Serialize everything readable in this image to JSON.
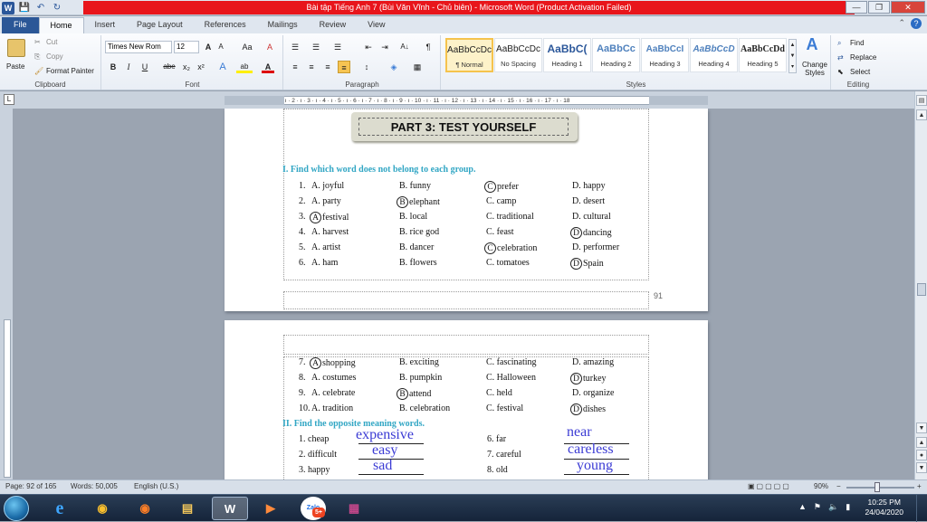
{
  "window": {
    "title": "Bài tập Tiếng Anh 7 (Bùi Văn Vĩnh - Chủ biên)  -  Microsoft Word (Product Activation Failed)",
    "qat_logo": "W",
    "qat_save": "💾",
    "qat_undo": "↶",
    "qat_redo": "↻",
    "minimize": "—",
    "restore": "❐",
    "close": "✕"
  },
  "tabs": [
    "File",
    "Home",
    "Insert",
    "Page Layout",
    "References",
    "Mailings",
    "Review",
    "View"
  ],
  "tab_icons": {
    "minimize_ribbon": "⌃",
    "help": "?"
  },
  "ribbon": {
    "clipboard": {
      "label": "Clipboard",
      "paste": "Paste",
      "cut": "Cut",
      "copy": "Copy",
      "format_painter": "Format Painter"
    },
    "font": {
      "label": "Font",
      "family": "Times New Rom",
      "size": "12",
      "grow": "A",
      "shrink": "A",
      "case": "Aa",
      "clear": "A",
      "bold": "B",
      "italic": "I",
      "underline": "U",
      "strike": "abe",
      "subscript": "x₂",
      "superscript": "x²",
      "effects": "A",
      "highlight": "ab",
      "color": "A"
    },
    "paragraph": {
      "label": "Paragraph",
      "bullets": "☰",
      "numbering": "☰",
      "multilevel": "☰",
      "decrease": "⇤",
      "increase": "⇥",
      "sort": "A↓",
      "pilcrow": "¶",
      "align_left": "≡",
      "center": "≡",
      "align_right": "≡",
      "justify": "≡",
      "spacing": "↕",
      "shading": "◈",
      "borders": "▦"
    },
    "styles": {
      "label": "Styles",
      "cards": [
        {
          "sample": "AaBbCcDc",
          "name": "¶ Normal"
        },
        {
          "sample": "AaBbCcDc",
          "name": "No Spacing"
        },
        {
          "sample": "AaBbC(",
          "name": "Heading 1"
        },
        {
          "sample": "AaBbCc",
          "name": "Heading 2"
        },
        {
          "sample": "AaBbCcI",
          "name": "Heading 3"
        },
        {
          "sample": "AaBbCcD",
          "name": "Heading 4"
        },
        {
          "sample": "AaBbCcDd",
          "name": "Heading 5"
        }
      ],
      "change_styles": "Change Styles",
      "change_icon": "A"
    },
    "editing": {
      "label": "Editing",
      "find": "Find",
      "replace": "Replace",
      "select": "Select"
    }
  },
  "ruler_text": "· 2 · ı · 1 · ı · ▽ · ı · 1 · ı · 2 · ı · 3 · ı · 4 · ı · 5 · ı · 6 · ı · 7 · ı · 8 · ı · 9 · ı · 10 · ı · 11 · ı · 12 · ı · 13 · ı · 14 · ı · 15 · ı · 16 · ı · 17 · ı · 18",
  "ruler_tab_symbol": "L",
  "document": {
    "part_title": "PART 3: TEST YOURSELF",
    "section1": "I.   Find which word does not belong to each group.",
    "questions_page1": [
      {
        "n": "1.",
        "a": "A. joyful",
        "b": "B. funny",
        "c": "prefer",
        "c_circle": "C",
        "d": "D. happy"
      },
      {
        "n": "2.",
        "a": "A. party",
        "b": "elephant",
        "b_circle": "B",
        "c": "C. camp",
        "d": "D. desert"
      },
      {
        "n": "3.",
        "a": "festival",
        "a_circle": "A",
        "b": "B. local",
        "c": "C. traditional",
        "d": "D. cultural"
      },
      {
        "n": "4.",
        "a": "A. harvest",
        "b": "B. rice god",
        "c": "C. feast",
        "d": "dancing",
        "d_circle": "D"
      },
      {
        "n": "5.",
        "a": "A. artist",
        "b": "B. dancer",
        "c": "celebration",
        "c_circle": "C",
        "d": "D. performer"
      },
      {
        "n": "6.",
        "a": "A. ham",
        "b": "B. flowers",
        "c": "C. tomatoes",
        "d": "Spain",
        "d_circle": "D"
      }
    ],
    "page_number": "91",
    "questions_page2": [
      {
        "n": "7.",
        "a": "shopping",
        "a_circle": "A",
        "b": "B. exciting",
        "c": "C. fascinating",
        "d": "D. amazing"
      },
      {
        "n": "8.",
        "a": "A. costumes",
        "b": "B. pumpkin",
        "c": "C. Halloween",
        "d": "turkey",
        "d_circle": "D"
      },
      {
        "n": "9.",
        "a": "A. celebrate",
        "b": "attend",
        "b_circle": "B",
        "c": "C. held",
        "d": "D. organize"
      },
      {
        "n": "10.",
        "a": "A. tradition",
        "b": "B. celebration",
        "c": "C. festival",
        "d": "dishes",
        "d_circle": "D"
      }
    ],
    "section2": "II.  Find the opposite meaning words.",
    "opposites": [
      {
        "left": "1. cheap",
        "left_answer": "expensive",
        "right": "6. far",
        "right_answer": "near"
      },
      {
        "left": "2. difficult",
        "left_answer": "easy",
        "right": "7. careful",
        "right_answer": "careless"
      },
      {
        "left": "3. happy",
        "left_answer": "sad",
        "right": "8. old",
        "right_answer": "young"
      }
    ]
  },
  "status": {
    "page": "Page: 92 of 165",
    "words": "Words: 50,005",
    "language": "English (U.S.)",
    "zoom": "90%",
    "zoom_out": "−",
    "zoom_in": "+"
  },
  "taskbar": {
    "apps": [
      {
        "name": "ie",
        "glyph": "e"
      },
      {
        "name": "chrome",
        "glyph": "◉"
      },
      {
        "name": "firefox",
        "glyph": "◉"
      },
      {
        "name": "explorer",
        "glyph": "▤"
      },
      {
        "name": "word",
        "glyph": "W"
      },
      {
        "name": "media",
        "glyph": "▶"
      },
      {
        "name": "zalo",
        "glyph": "Zalo"
      },
      {
        "name": "winrar",
        "glyph": "▦"
      }
    ],
    "zalo_badge": "5+",
    "tray_up": "▲",
    "tray_flag": "⚑",
    "tray_sound": "🔈",
    "tray_signal": "▮",
    "time": "10:25 PM",
    "date": "24/04/2020"
  },
  "scrollbar": {
    "up": "▲",
    "down": "▼",
    "prev": "▲",
    "next": "▼",
    "select_browse": "●"
  },
  "colors": {
    "title_bar": "#e8151b",
    "heading_cyan": "#31a6c4",
    "handwriting": "#3b3bd4",
    "file_tab": "#2b5797"
  }
}
